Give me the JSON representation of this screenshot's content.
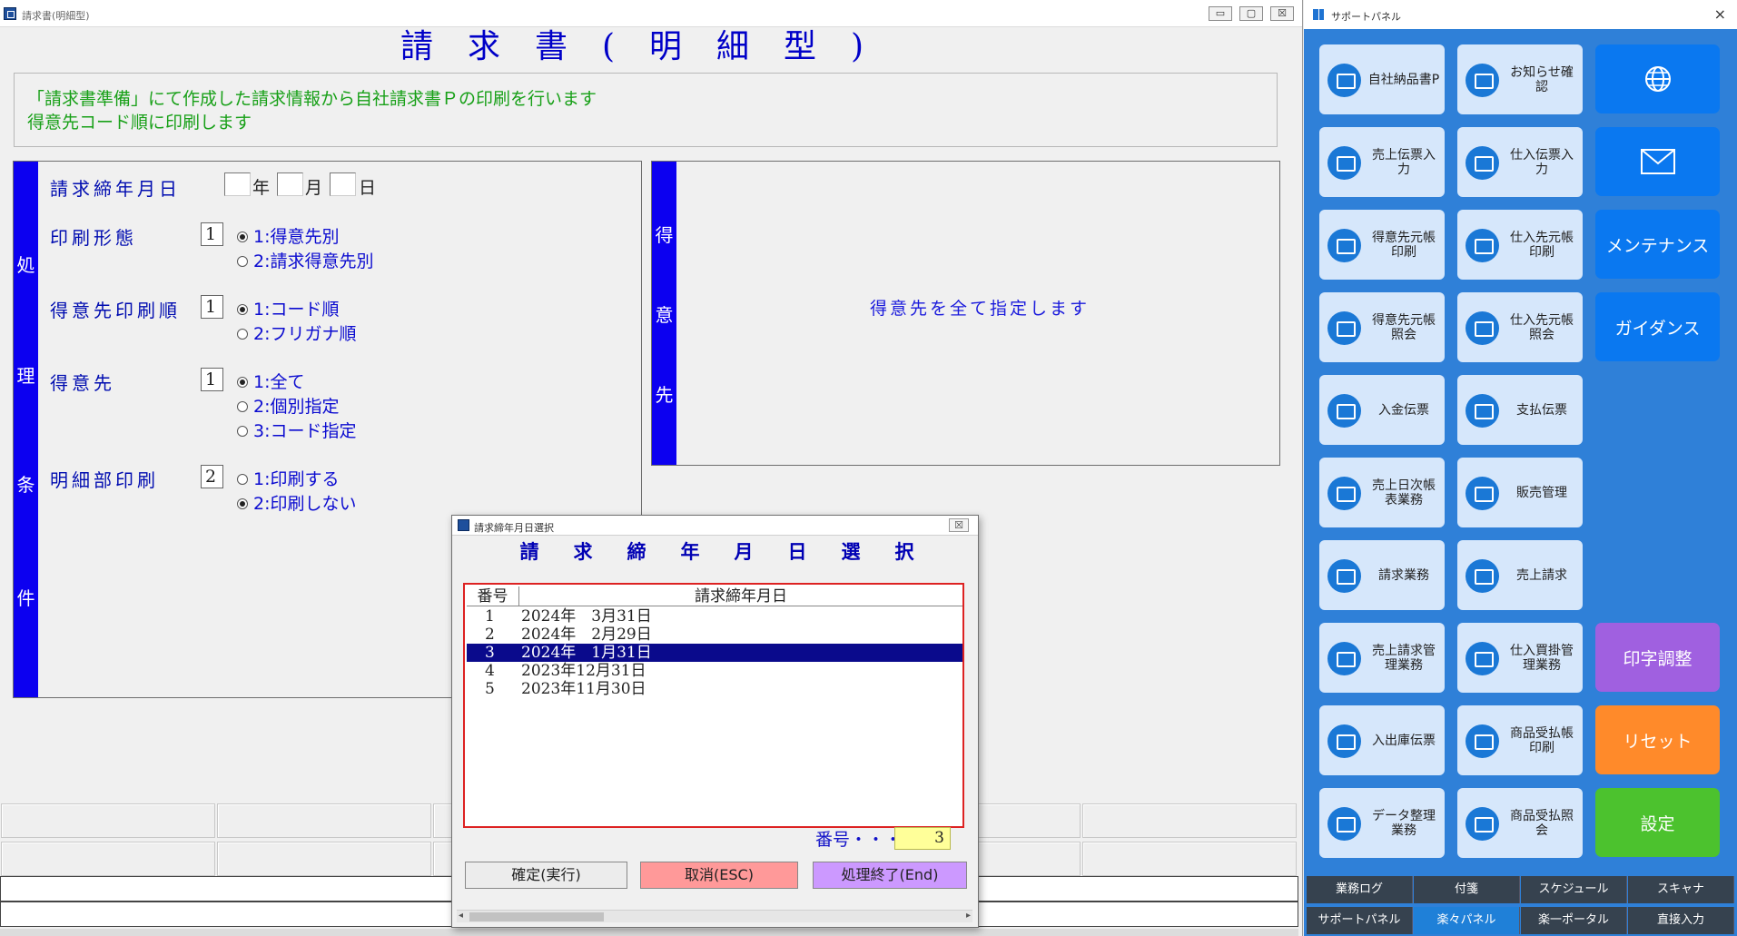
{
  "main_window": {
    "title": "請求書(明細型)",
    "controls": {
      "minimize": "▭",
      "maximize": "▢",
      "close": "☒"
    },
    "heading": "請求書(明細型)",
    "description": [
      "「請求書準備」にて作成した請求情報から自社請求書Ｐの印刷を行います",
      "得意先コード順に印刷します"
    ],
    "condition_panel": {
      "strip_chars": [
        "処",
        "理",
        "条",
        "件"
      ],
      "billing_date": {
        "label": "請求締年月日",
        "year_unit": "年",
        "month_unit": "月",
        "day_unit": "日",
        "year": "",
        "month": "",
        "day": ""
      },
      "print_form": {
        "label": "印刷形態",
        "value": "1",
        "options": [
          "1:得意先別",
          "2:請求得意先別"
        ],
        "selected": 0
      },
      "customer_order": {
        "label": "得意先印刷順",
        "value": "1",
        "options": [
          "1:コード順",
          "2:フリガナ順"
        ],
        "selected": 0
      },
      "customer": {
        "label": "得意先",
        "value": "1",
        "options": [
          "1:全て",
          "2:個別指定",
          "3:コード指定"
        ],
        "selected": 0
      },
      "detail_print": {
        "label": "明細部印刷",
        "value": "2",
        "options": [
          "1:印刷する",
          "2:印刷しない"
        ],
        "selected": 1
      }
    },
    "customer_panel": {
      "strip_chars": [
        "得",
        "意",
        "先"
      ],
      "message": "得意先を全て指定します"
    }
  },
  "dialog": {
    "title": "請求締年月日選択",
    "heading": "請求締年月日選択",
    "columns": [
      "番号",
      "請求締年月日"
    ],
    "rows": [
      {
        "no": "1",
        "date": "2024年　3月31日"
      },
      {
        "no": "2",
        "date": "2024年　2月29日"
      },
      {
        "no": "3",
        "date": "2024年　1月31日"
      },
      {
        "no": "4",
        "date": "2023年12月31日"
      },
      {
        "no": "5",
        "date": "2023年11月30日"
      }
    ],
    "selected_index": 2,
    "number_label": "番号・・・",
    "number_value": "3",
    "buttons": {
      "confirm": "確定(実行)",
      "cancel": "取消(ESC)",
      "end": "処理終了(End)"
    },
    "colors": {
      "cancel": "#ff9999",
      "end": "#cc99ff",
      "selection": "#0a0a8c"
    }
  },
  "support_panel": {
    "title": "サポートパネル",
    "close": "×",
    "tiles": [
      {
        "label": "自社納品書P",
        "icon": "printer-icon"
      },
      {
        "label": "お知らせ確認",
        "icon": "notice-icon"
      },
      {
        "label": "売上伝票入力",
        "icon": "sales-slip-icon"
      },
      {
        "label": "仕入伝票入力",
        "icon": "purchase-slip-icon"
      },
      {
        "label": "得意先元帳印刷",
        "icon": "ledger-print-icon"
      },
      {
        "label": "仕入先元帳印刷",
        "icon": "ledger-print-icon"
      },
      {
        "label": "得意先元帳照会",
        "icon": "ledger-view-icon"
      },
      {
        "label": "仕入先元帳照会",
        "icon": "ledger-view-icon"
      },
      {
        "label": "入金伝票",
        "icon": "deposit-icon"
      },
      {
        "label": "支払伝票",
        "icon": "payment-icon"
      },
      {
        "label": "売上日次帳表業務",
        "icon": "folder-icon"
      },
      {
        "label": "販売管理",
        "icon": "folder-icon"
      },
      {
        "label": "請求業務",
        "icon": "folder-icon"
      },
      {
        "label": "売上請求",
        "icon": "folder-icon"
      },
      {
        "label": "売上請求管理業務",
        "icon": "folder-icon"
      },
      {
        "label": "仕入買掛管理業務",
        "icon": "folder-icon"
      },
      {
        "label": "入出庫伝票",
        "icon": "stock-icon"
      },
      {
        "label": "商品受払帳印刷",
        "icon": "ledger-print-icon"
      },
      {
        "label": "データ整理業務",
        "icon": "folder-icon"
      },
      {
        "label": "商品受払照会",
        "icon": "ledger-view-icon"
      }
    ],
    "big_buttons": [
      {
        "label": "",
        "icon": "globe-icon",
        "color": "#0a78f0"
      },
      {
        "label": "",
        "icon": "mail-icon",
        "color": "#0a78f0"
      },
      {
        "label": "メンテナンス",
        "color": "#0a78f0"
      },
      {
        "label": "ガイダンス",
        "color": "#0a78f0"
      },
      {
        "label": "印字調整",
        "color": "#a060e0"
      },
      {
        "label": "リセット",
        "color": "#ff8a2a"
      },
      {
        "label": "設定",
        "color": "#4cc22e"
      }
    ],
    "bottom_tabs": [
      {
        "label": "業務ログ",
        "active": false
      },
      {
        "label": "付箋",
        "active": false
      },
      {
        "label": "スケジュール",
        "active": false
      },
      {
        "label": "スキャナ",
        "active": false
      },
      {
        "label": "サポートパネル",
        "active": false
      },
      {
        "label": "楽々パネル",
        "active": true
      },
      {
        "label": "楽一ポータル",
        "active": false
      },
      {
        "label": "直接入力",
        "active": false
      }
    ]
  }
}
